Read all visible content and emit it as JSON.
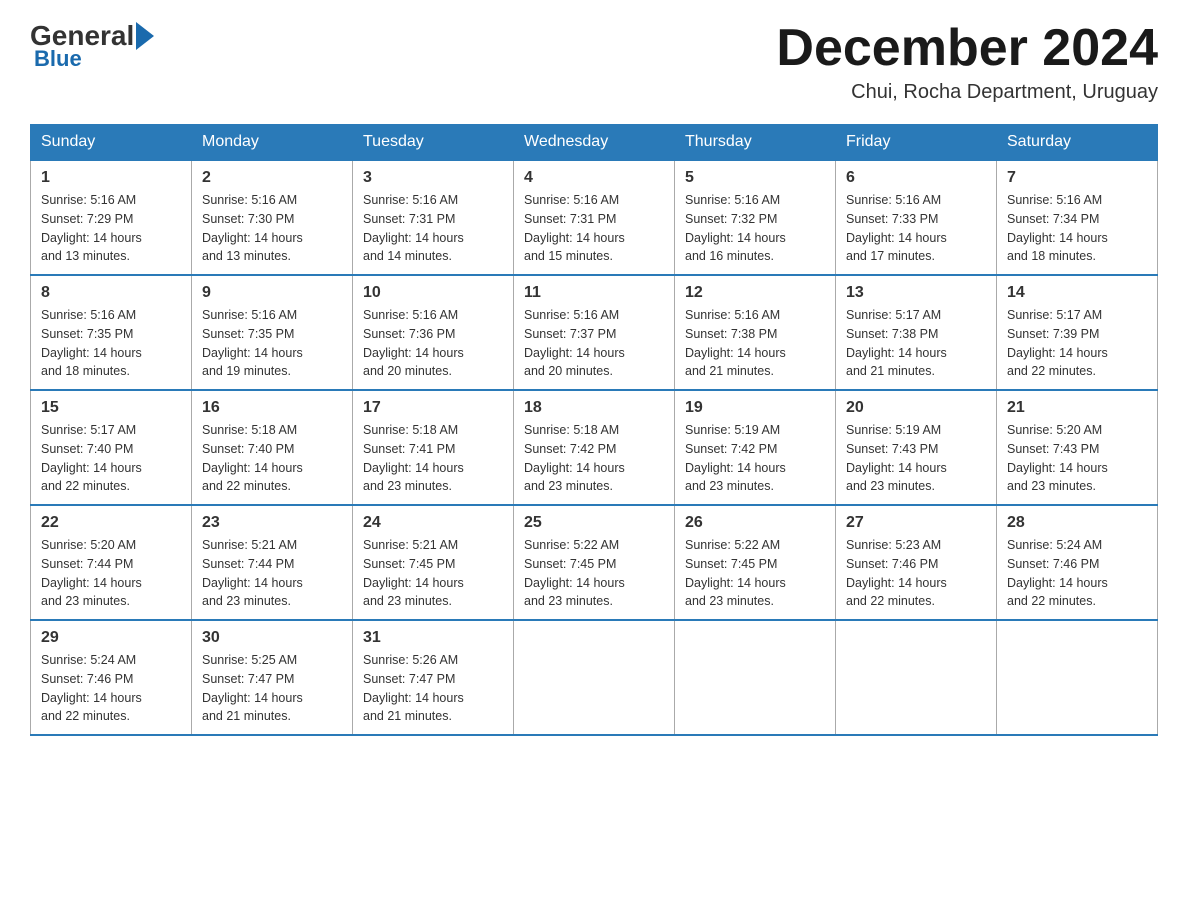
{
  "header": {
    "logo": {
      "general": "General",
      "blue": "Blue"
    },
    "month_title": "December 2024",
    "location": "Chui, Rocha Department, Uruguay"
  },
  "weekdays": [
    "Sunday",
    "Monday",
    "Tuesday",
    "Wednesday",
    "Thursday",
    "Friday",
    "Saturday"
  ],
  "weeks": [
    [
      {
        "day": "1",
        "sunrise": "5:16 AM",
        "sunset": "7:29 PM",
        "daylight": "14 hours and 13 minutes."
      },
      {
        "day": "2",
        "sunrise": "5:16 AM",
        "sunset": "7:30 PM",
        "daylight": "14 hours and 13 minutes."
      },
      {
        "day": "3",
        "sunrise": "5:16 AM",
        "sunset": "7:31 PM",
        "daylight": "14 hours and 14 minutes."
      },
      {
        "day": "4",
        "sunrise": "5:16 AM",
        "sunset": "7:31 PM",
        "daylight": "14 hours and 15 minutes."
      },
      {
        "day": "5",
        "sunrise": "5:16 AM",
        "sunset": "7:32 PM",
        "daylight": "14 hours and 16 minutes."
      },
      {
        "day": "6",
        "sunrise": "5:16 AM",
        "sunset": "7:33 PM",
        "daylight": "14 hours and 17 minutes."
      },
      {
        "day": "7",
        "sunrise": "5:16 AM",
        "sunset": "7:34 PM",
        "daylight": "14 hours and 18 minutes."
      }
    ],
    [
      {
        "day": "8",
        "sunrise": "5:16 AM",
        "sunset": "7:35 PM",
        "daylight": "14 hours and 18 minutes."
      },
      {
        "day": "9",
        "sunrise": "5:16 AM",
        "sunset": "7:35 PM",
        "daylight": "14 hours and 19 minutes."
      },
      {
        "day": "10",
        "sunrise": "5:16 AM",
        "sunset": "7:36 PM",
        "daylight": "14 hours and 20 minutes."
      },
      {
        "day": "11",
        "sunrise": "5:16 AM",
        "sunset": "7:37 PM",
        "daylight": "14 hours and 20 minutes."
      },
      {
        "day": "12",
        "sunrise": "5:16 AM",
        "sunset": "7:38 PM",
        "daylight": "14 hours and 21 minutes."
      },
      {
        "day": "13",
        "sunrise": "5:17 AM",
        "sunset": "7:38 PM",
        "daylight": "14 hours and 21 minutes."
      },
      {
        "day": "14",
        "sunrise": "5:17 AM",
        "sunset": "7:39 PM",
        "daylight": "14 hours and 22 minutes."
      }
    ],
    [
      {
        "day": "15",
        "sunrise": "5:17 AM",
        "sunset": "7:40 PM",
        "daylight": "14 hours and 22 minutes."
      },
      {
        "day": "16",
        "sunrise": "5:18 AM",
        "sunset": "7:40 PM",
        "daylight": "14 hours and 22 minutes."
      },
      {
        "day": "17",
        "sunrise": "5:18 AM",
        "sunset": "7:41 PM",
        "daylight": "14 hours and 23 minutes."
      },
      {
        "day": "18",
        "sunrise": "5:18 AM",
        "sunset": "7:42 PM",
        "daylight": "14 hours and 23 minutes."
      },
      {
        "day": "19",
        "sunrise": "5:19 AM",
        "sunset": "7:42 PM",
        "daylight": "14 hours and 23 minutes."
      },
      {
        "day": "20",
        "sunrise": "5:19 AM",
        "sunset": "7:43 PM",
        "daylight": "14 hours and 23 minutes."
      },
      {
        "day": "21",
        "sunrise": "5:20 AM",
        "sunset": "7:43 PM",
        "daylight": "14 hours and 23 minutes."
      }
    ],
    [
      {
        "day": "22",
        "sunrise": "5:20 AM",
        "sunset": "7:44 PM",
        "daylight": "14 hours and 23 minutes."
      },
      {
        "day": "23",
        "sunrise": "5:21 AM",
        "sunset": "7:44 PM",
        "daylight": "14 hours and 23 minutes."
      },
      {
        "day": "24",
        "sunrise": "5:21 AM",
        "sunset": "7:45 PM",
        "daylight": "14 hours and 23 minutes."
      },
      {
        "day": "25",
        "sunrise": "5:22 AM",
        "sunset": "7:45 PM",
        "daylight": "14 hours and 23 minutes."
      },
      {
        "day": "26",
        "sunrise": "5:22 AM",
        "sunset": "7:45 PM",
        "daylight": "14 hours and 23 minutes."
      },
      {
        "day": "27",
        "sunrise": "5:23 AM",
        "sunset": "7:46 PM",
        "daylight": "14 hours and 22 minutes."
      },
      {
        "day": "28",
        "sunrise": "5:24 AM",
        "sunset": "7:46 PM",
        "daylight": "14 hours and 22 minutes."
      }
    ],
    [
      {
        "day": "29",
        "sunrise": "5:24 AM",
        "sunset": "7:46 PM",
        "daylight": "14 hours and 22 minutes."
      },
      {
        "day": "30",
        "sunrise": "5:25 AM",
        "sunset": "7:47 PM",
        "daylight": "14 hours and 21 minutes."
      },
      {
        "day": "31",
        "sunrise": "5:26 AM",
        "sunset": "7:47 PM",
        "daylight": "14 hours and 21 minutes."
      },
      null,
      null,
      null,
      null
    ]
  ],
  "labels": {
    "sunrise": "Sunrise:",
    "sunset": "Sunset:",
    "daylight": "Daylight:"
  }
}
